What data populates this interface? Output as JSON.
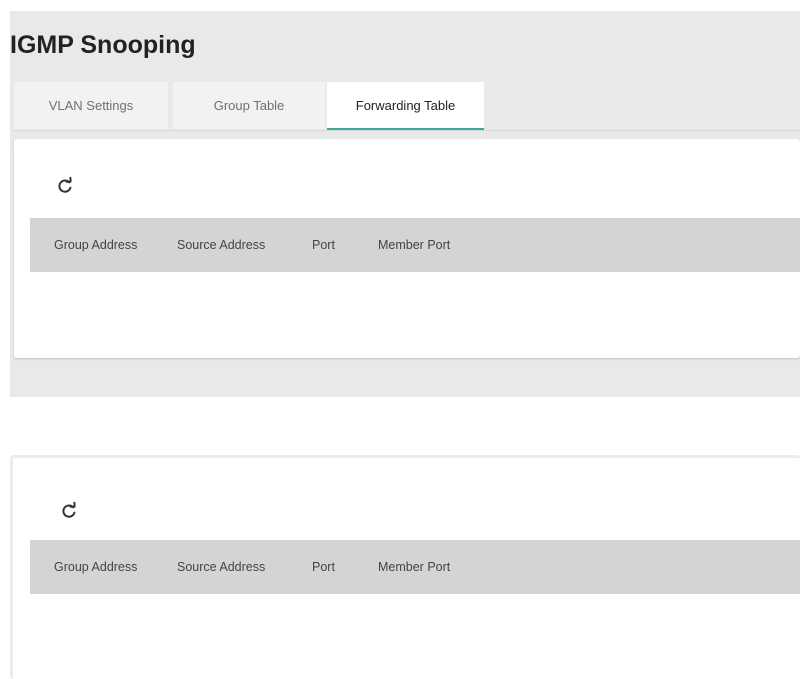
{
  "page": {
    "title": "IGMP Snooping"
  },
  "tabs": [
    {
      "label": "VLAN Settings",
      "active": false
    },
    {
      "label": "Group Table",
      "active": false
    },
    {
      "label": "Forwarding Table",
      "active": true
    }
  ],
  "icons": {
    "refresh": "refresh-icon"
  },
  "colors": {
    "accent": "#3aa89a",
    "panel_background": "#e9e9e9",
    "table_header_background": "#d4d4d4"
  },
  "tables": [
    {
      "columns": [
        "Group Address",
        "Source Address",
        "Port",
        "Member Port"
      ],
      "rows": []
    },
    {
      "columns": [
        "Group Address",
        "Source Address",
        "Port",
        "Member Port"
      ],
      "rows": []
    }
  ]
}
